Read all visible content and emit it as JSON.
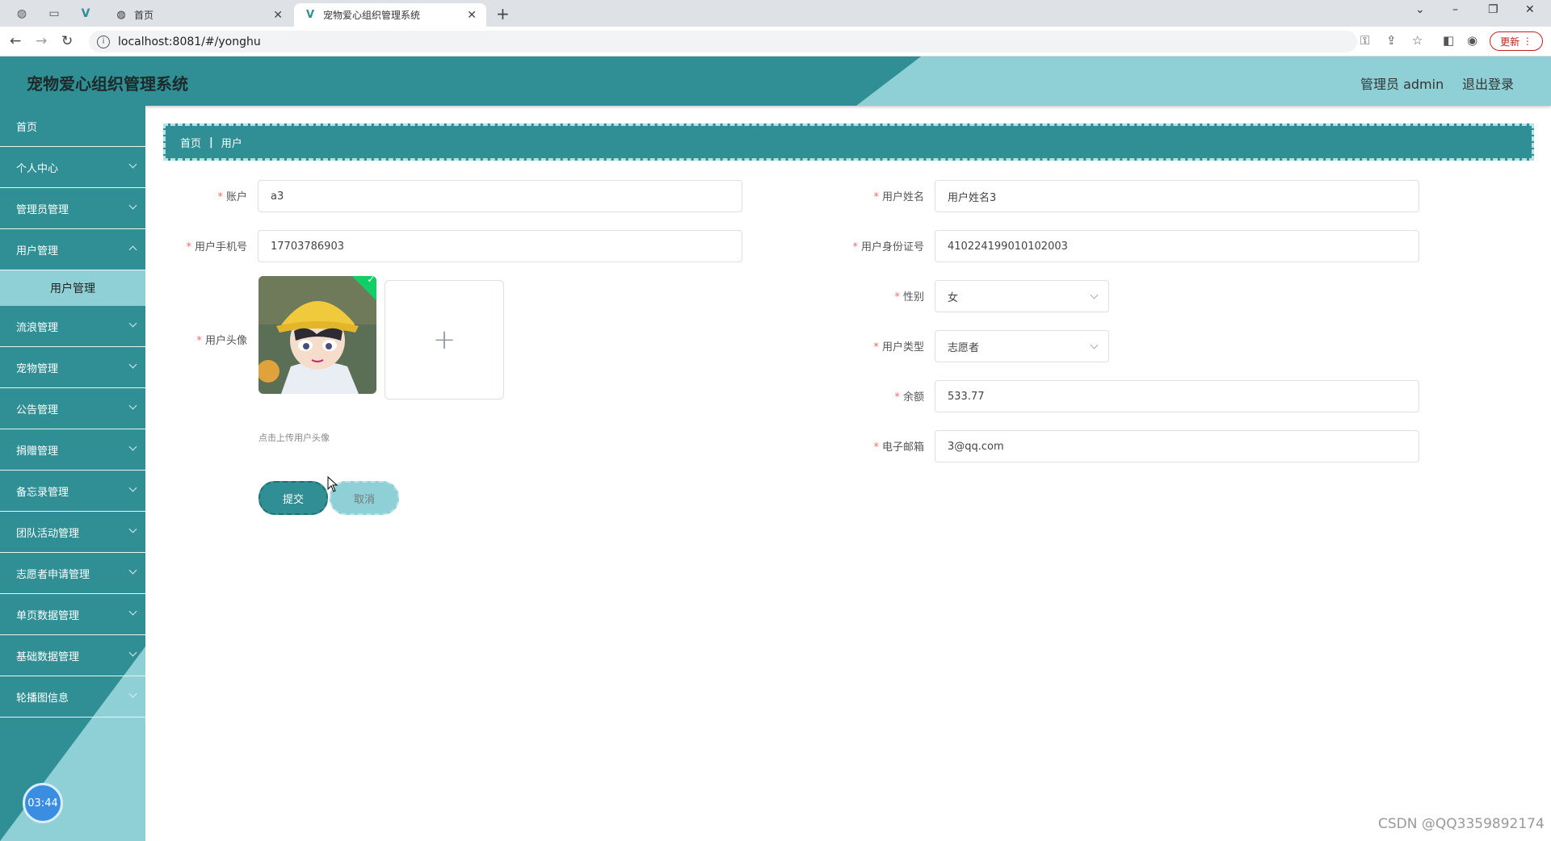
{
  "browser": {
    "tabs": [
      {
        "title": "首页",
        "active": false
      },
      {
        "title": "宠物爱心组织管理系统",
        "active": true
      }
    ],
    "url": "localhost:8081/#/yonghu",
    "update_label": "更新"
  },
  "header": {
    "title": "宠物爱心组织管理系统",
    "user_label": "管理员 admin",
    "logout_label": "退出登录"
  },
  "sidebar": {
    "items": [
      {
        "label": "首页"
      },
      {
        "label": "个人中心"
      },
      {
        "label": "管理员管理"
      },
      {
        "label": "用户管理"
      },
      {
        "label": "流浪管理"
      },
      {
        "label": "宠物管理"
      },
      {
        "label": "公告管理"
      },
      {
        "label": "捐赠管理"
      },
      {
        "label": "备忘录管理"
      },
      {
        "label": "团队活动管理"
      },
      {
        "label": "志愿者申请管理"
      },
      {
        "label": "单页数据管理"
      },
      {
        "label": "基础数据管理"
      },
      {
        "label": "轮播图信息"
      }
    ],
    "submenu": {
      "label": "用户管理"
    },
    "timer": "03:44"
  },
  "breadcrumb": {
    "home": "首页",
    "current": "用户"
  },
  "form": {
    "account": {
      "label": "账户",
      "value": "a3"
    },
    "name": {
      "label": "用户姓名",
      "value": "用户姓名3"
    },
    "phone": {
      "label": "用户手机号",
      "value": "17703786903"
    },
    "id_number": {
      "label": "用户身份证号",
      "value": "410224199010102003"
    },
    "avatar": {
      "label": "用户头像",
      "hint": "点击上传用户头像"
    },
    "gender": {
      "label": "性别",
      "value": "女"
    },
    "user_type": {
      "label": "用户类型",
      "value": "志愿者"
    },
    "balance": {
      "label": "余额",
      "value": "533.77"
    },
    "email": {
      "label": "电子邮箱",
      "value": "3@qq.com"
    },
    "submit_label": "提交",
    "cancel_label": "取消"
  },
  "watermark": "CSDN @QQ3359892174",
  "colors": {
    "primary": "#2f8f95",
    "light": "#8fd0d6",
    "required": "#f56c6c"
  }
}
